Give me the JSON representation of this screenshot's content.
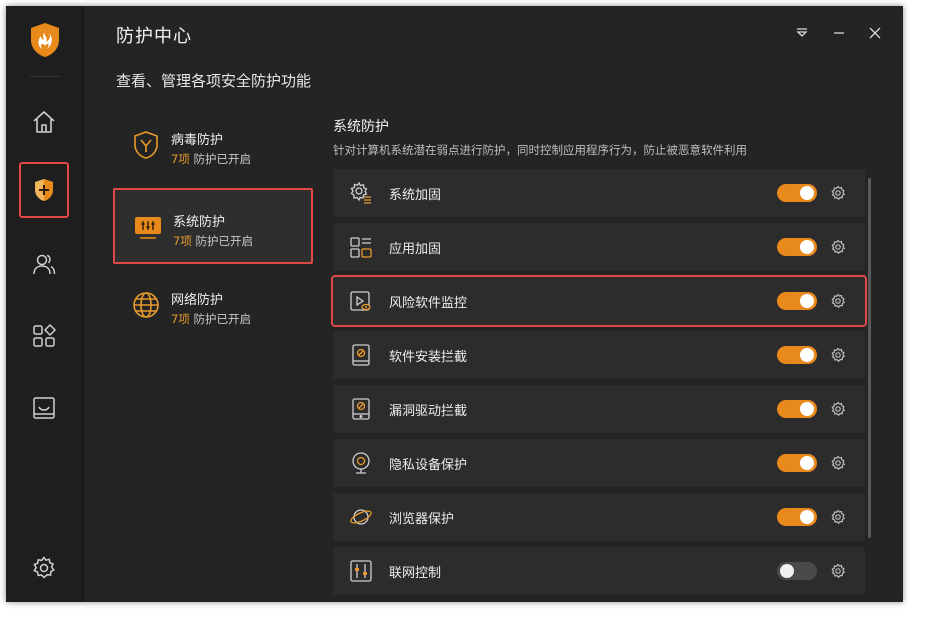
{
  "header": {
    "title": "防护中心",
    "subtitle": "查看、管理各项安全防护功能"
  },
  "rail": {
    "items": [
      "home-icon",
      "shield-plus-icon",
      "users-icon",
      "apps-icon",
      "inbox-icon",
      "settings-icon"
    ],
    "active": "shield-plus-icon"
  },
  "categories": [
    {
      "title": "病毒防护",
      "count": "7项",
      "status": "防护已开启",
      "active": false
    },
    {
      "title": "系统防护",
      "count": "7项",
      "status": "防护已开启",
      "active": true
    },
    {
      "title": "网络防护",
      "count": "7项",
      "status": "防护已开启",
      "active": false
    }
  ],
  "section": {
    "title": "系统防护",
    "description": "针对计算机系统潜在弱点进行防护，同时控制应用程序行为，防止被恶意软件利用"
  },
  "items": [
    {
      "label": "系统加固",
      "icon": "system-hardening-icon",
      "enabled": true
    },
    {
      "label": "应用加固",
      "icon": "app-hardening-icon",
      "enabled": true
    },
    {
      "label": "风险软件监控",
      "icon": "risk-monitor-icon",
      "enabled": true
    },
    {
      "label": "软件安装拦截",
      "icon": "install-block-icon",
      "enabled": true
    },
    {
      "label": "漏洞驱动拦截",
      "icon": "driver-block-icon",
      "enabled": true
    },
    {
      "label": "隐私设备保护",
      "icon": "webcam-icon",
      "enabled": true
    },
    {
      "label": "浏览器保护",
      "icon": "browser-icon",
      "enabled": true
    },
    {
      "label": "联网控制",
      "icon": "network-control-icon",
      "enabled": false
    }
  ],
  "colors": {
    "accent": "#e8891b",
    "highlight": "#e04848",
    "background": "#242424"
  }
}
